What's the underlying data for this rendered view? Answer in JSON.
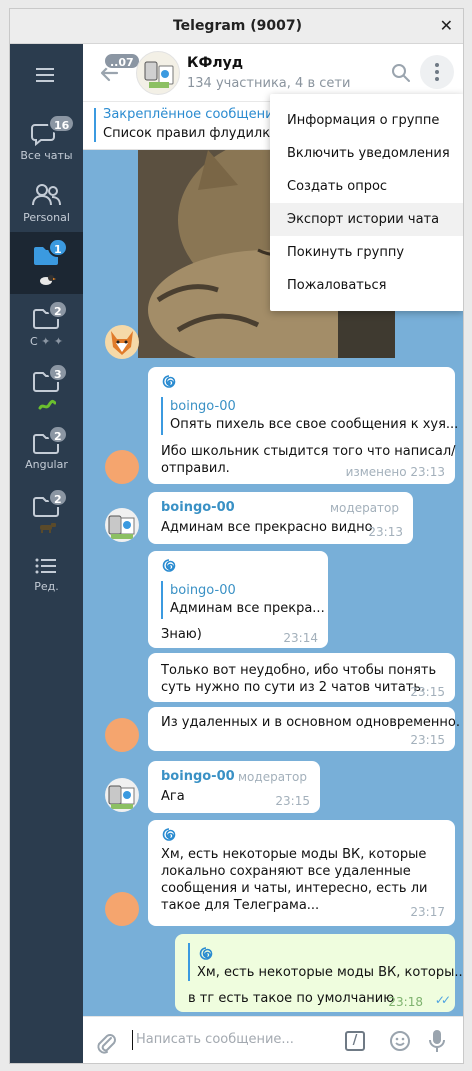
{
  "window": {
    "title": "Telegram (9007)",
    "close_glyph": "✕"
  },
  "sidebar": {
    "menu_icon": "hamburger-icon",
    "items": [
      {
        "label": "Все чаты",
        "badge": "16",
        "icon": "chat-bubbles-icon"
      },
      {
        "label": "Personal",
        "badge": "",
        "icon": "people-icon"
      },
      {
        "label": "",
        "badge": "1",
        "icon": "folder-icon",
        "active": true
      },
      {
        "label": "С",
        "badge": "2",
        "icon": "folder-icon"
      },
      {
        "label": "",
        "badge": "3",
        "icon": "folder-icon"
      },
      {
        "label": "Angular",
        "badge": "2",
        "icon": "folder-icon"
      },
      {
        "label": "",
        "badge": "2",
        "icon": "folder-icon"
      },
      {
        "label": "Ред.",
        "badge": "",
        "icon": "edit-list-icon"
      }
    ]
  },
  "header": {
    "back_badge": "..07",
    "chat_name": "КФлуд",
    "chat_status": "134 участника, 4 в сети"
  },
  "pinned": {
    "title": "Закреплённое сообщение",
    "text": "Список правил флудилки."
  },
  "messages": [
    {
      "quote_name": "boingo-00",
      "quote_text": "Опять пихель все свое сообщения к хуя...",
      "lines": [
        "Ибо школьник стыдится того что написал/",
        "отправил."
      ],
      "time": "изменено 23:13"
    },
    {
      "author": "boingo-00",
      "role": "модератор",
      "lines": [
        "Админам все прекрасно видно"
      ],
      "time": "23:13"
    },
    {
      "quote_name": "boingo-00",
      "quote_text": "Админам все прекра...",
      "lines": [
        "Знаю)"
      ],
      "time": "23:14"
    },
    {
      "lines": [
        "Только вот неудобно, ибо чтобы понять",
        "суть нужно по сути из 2 чатов читать."
      ],
      "time": "23:15"
    },
    {
      "lines": [
        "Из удаленных и в основном одновременно."
      ],
      "time": "23:15"
    },
    {
      "author": "boingo-00",
      "role": "модератор",
      "lines": [
        "Ага"
      ],
      "time": "23:15"
    },
    {
      "lines": [
        "Хм, есть некоторые моды ВК, которые",
        "локально сохраняют все удаленные",
        "сообщения и чаты, интересно, есть ли",
        "такое для Телеграма..."
      ],
      "time": "23:17"
    },
    {
      "quote_text": "Хм, есть некоторые моды ВК, которы...",
      "lines": [
        "в тг есть такое по умолчанию"
      ],
      "time": "23:18",
      "read_status": "✓✓"
    }
  ],
  "input": {
    "placeholder": "Написать сообщение...",
    "command_glyph": "/"
  },
  "menu": {
    "items": [
      {
        "label": "Информация о группе"
      },
      {
        "label": "Включить уведомления"
      },
      {
        "label": "Создать опрос"
      },
      {
        "label": "Экспорт истории чата",
        "hover": true
      },
      {
        "label": "Покинуть группу"
      },
      {
        "label": "Пожаловаться"
      }
    ]
  },
  "colors": {
    "sidebar_bg": "#2b3c4e",
    "chat_bg": "#78afd8",
    "accent": "#3b9ae0",
    "outgoing_bubble": "#effdde"
  }
}
